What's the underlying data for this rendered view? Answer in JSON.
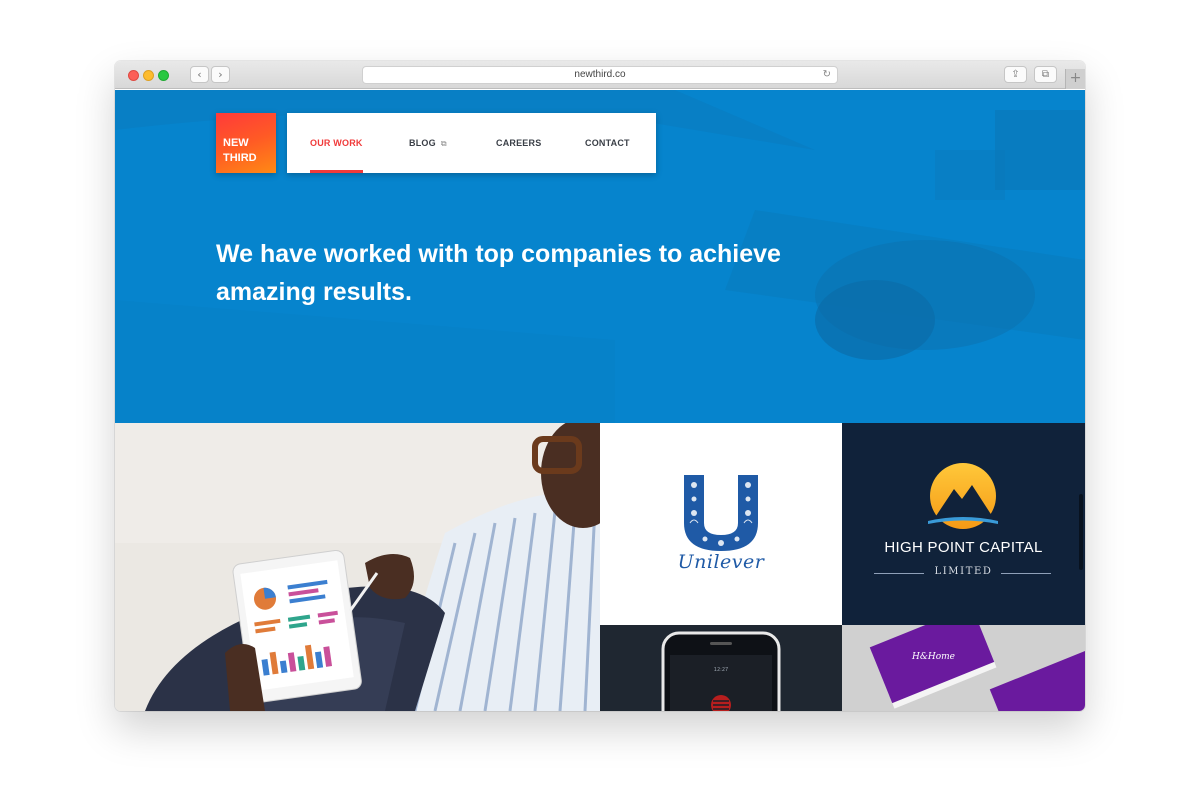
{
  "browser": {
    "url": "newthird.co",
    "back_icon": "‹",
    "forward_icon": "›",
    "reload_icon": "↻",
    "share_icon": "⇪",
    "tabs_icon": "⧉",
    "newtab_icon": "+"
  },
  "logo": {
    "line1": "NEW",
    "line2": "THIRD"
  },
  "nav": {
    "items": [
      {
        "label": "OUR WORK",
        "active": true
      },
      {
        "label": "BLOG",
        "external": true
      },
      {
        "label": "CAREERS"
      },
      {
        "label": "CONTACT"
      }
    ],
    "external_icon": "⧉"
  },
  "hero": {
    "headline_line1": "We have worked with top companies to achieve",
    "headline_line2": "amazing results."
  },
  "portfolio": {
    "unilever": {
      "wordmark": "Unilever"
    },
    "highpoint": {
      "name": "HIGH POINT CAPITAL",
      "limited": "LIMITED"
    },
    "cards": {
      "brand": "H&Home"
    }
  },
  "colors": {
    "hero_blue": "#0684cd",
    "accent_red": "#f03a3a",
    "logo_orange": "#ff5a25",
    "unilever_blue": "#1f5aa6",
    "hpc_navy": "#10223a",
    "card_purple": "#6a1a9e"
  }
}
